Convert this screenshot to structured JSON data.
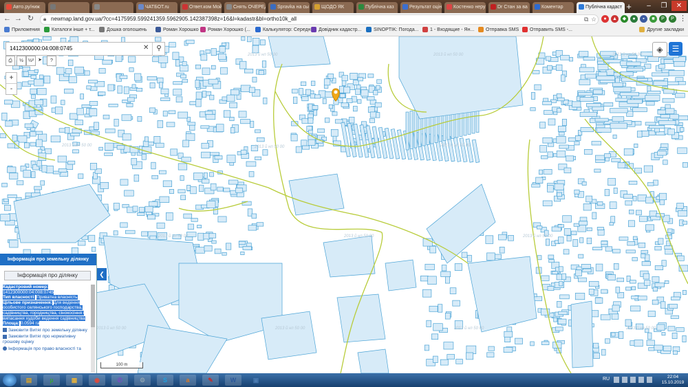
{
  "browser": {
    "tabs": [
      {
        "label": "Авто.ру/ниж",
        "fav": "#e84a3a"
      },
      {
        "label": "",
        "fav": "#777"
      },
      {
        "label": "",
        "fav": "#888"
      },
      {
        "label": "ЧАТБОТ.ru",
        "fav": "#6a88c9"
      },
      {
        "label": "Ответ.ком Мой",
        "fav": "#c33"
      },
      {
        "label": "Снять ОЧЕРЕДЬ",
        "fav": "#8a8a8a"
      },
      {
        "label": "Spravka на сы",
        "fav": "#3a6cc0"
      },
      {
        "label": "ЩОДО ЯК",
        "fav": "#d4a030"
      },
      {
        "label": "Публічна каз",
        "fav": "#2b8a3e"
      },
      {
        "label": "Результат оцін",
        "fav": "#3b6fd0"
      },
      {
        "label": "Костенко нерухо",
        "fav": "#d44"
      },
      {
        "label": "Dr Стан за ва",
        "fav": "#c02020"
      },
      {
        "label": "Коментар ",
        "fav": "#2d6ad0"
      },
      {
        "label": "Публічна кадаст",
        "fav": "#2f7bd9"
      }
    ],
    "active_tab": 13,
    "new_tab_symbol": "+",
    "url": "newmap.land.gov.ua/?cc=4175959.599241359.5962905.142387398z=16&l=kadastr&bl=ortho10k_all",
    "back_symbol": "←",
    "forward_symbol": "→",
    "reload_symbol": "↻",
    "window_controls": [
      "–",
      "❐",
      "✕"
    ],
    "bookmarks": [
      {
        "label": "Приложения",
        "color": "#4a7bd0"
      },
      {
        "label": "Каталоги інше + т...",
        "color": "#2a9a3a"
      },
      {
        "label": "Дошка оголошень",
        "color": "#777"
      },
      {
        "label": "Роман Хорошко",
        "color": "#3b5998"
      },
      {
        "label": "Роман Хорошко (...",
        "color": "#c13584"
      },
      {
        "label": "Калькулятор: Середн...",
        "color": "#2a6ad0"
      },
      {
        "label": "Довідник кадастр...",
        "color": "#6a3ab0"
      },
      {
        "label": "SINOPTIK: Погода...",
        "color": "#1a6fc0"
      },
      {
        "label": "1 - Входящие - Ян...",
        "color": "#d04040"
      },
      {
        "label": "Отправка SMS",
        "color": "#e58a20"
      },
      {
        "label": "Отправить SMS -...",
        "color": "#e03030"
      }
    ],
    "other_bookmarks": "Другие закладки"
  },
  "map": {
    "search_value": "1412300000:04:008:0745",
    "search_clear_symbol": "✕",
    "search_icon_symbol": "⚲",
    "tools": [
      "⎙",
      "½",
      "½²",
      "➤",
      "?"
    ],
    "zoom_in": "+",
    "zoom_out": "-",
    "scale_label": "100 m",
    "watermark": "2013 й нп 50 00",
    "marker_color": "#f0a818",
    "parcel_stroke": "#4aa3d6",
    "parcel_fill": "#d7ebf8",
    "boundary_color": "#b8cc3a"
  },
  "panel": {
    "header": "Інформація про земельну ділянку",
    "subtitle": "Інформація про ділянку",
    "toggle_symbol": "❮",
    "cadastral_label": "Кадастровий номер:",
    "cadastral_value": "1412300000:04:008:0745",
    "ownership_label": "Тип власності:",
    "ownership_value": "Приватна власність",
    "purpose_label": "Цільове призначення:",
    "purpose_value": "Для ведення особистого селянського господарства, садівництва, городництва, сінокосіння і випасання худоби ведення садівництва",
    "area_label": "Площа:",
    "area_value": "0.0594 га",
    "links": [
      "Замовити Витяг про земельну ділянку",
      "Замовити Витяг про нормативну грошову оцінку",
      "Інформація про право власності та"
    ]
  },
  "taskbar": {
    "language": "RU",
    "time": "22:04",
    "date": "15.10.2019",
    "apps": [
      {
        "name": "explorer",
        "symbol": "▤",
        "color": "#d0a030"
      },
      {
        "name": "utorrent",
        "symbol": "µ",
        "color": "#3ca03c"
      },
      {
        "name": "files",
        "symbol": "▦",
        "color": "#e0b040"
      },
      {
        "name": "chrome",
        "symbol": "◉",
        "color": "#e04a3a"
      },
      {
        "name": "viber",
        "symbol": "✆",
        "color": "#7a4ac0"
      },
      {
        "name": "settings",
        "symbol": "⚙",
        "color": "#8aa0b0"
      },
      {
        "name": "skype",
        "symbol": "S",
        "color": "#1ea0e0"
      },
      {
        "name": "app-orange",
        "symbol": "a",
        "color": "#e07a20"
      },
      {
        "name": "tool",
        "symbol": "✎",
        "color": "#c03030"
      },
      {
        "name": "word",
        "symbol": "W",
        "color": "#2b579a"
      },
      {
        "name": "viewer",
        "symbol": "▣",
        "color": "#4a7ab0"
      }
    ]
  }
}
